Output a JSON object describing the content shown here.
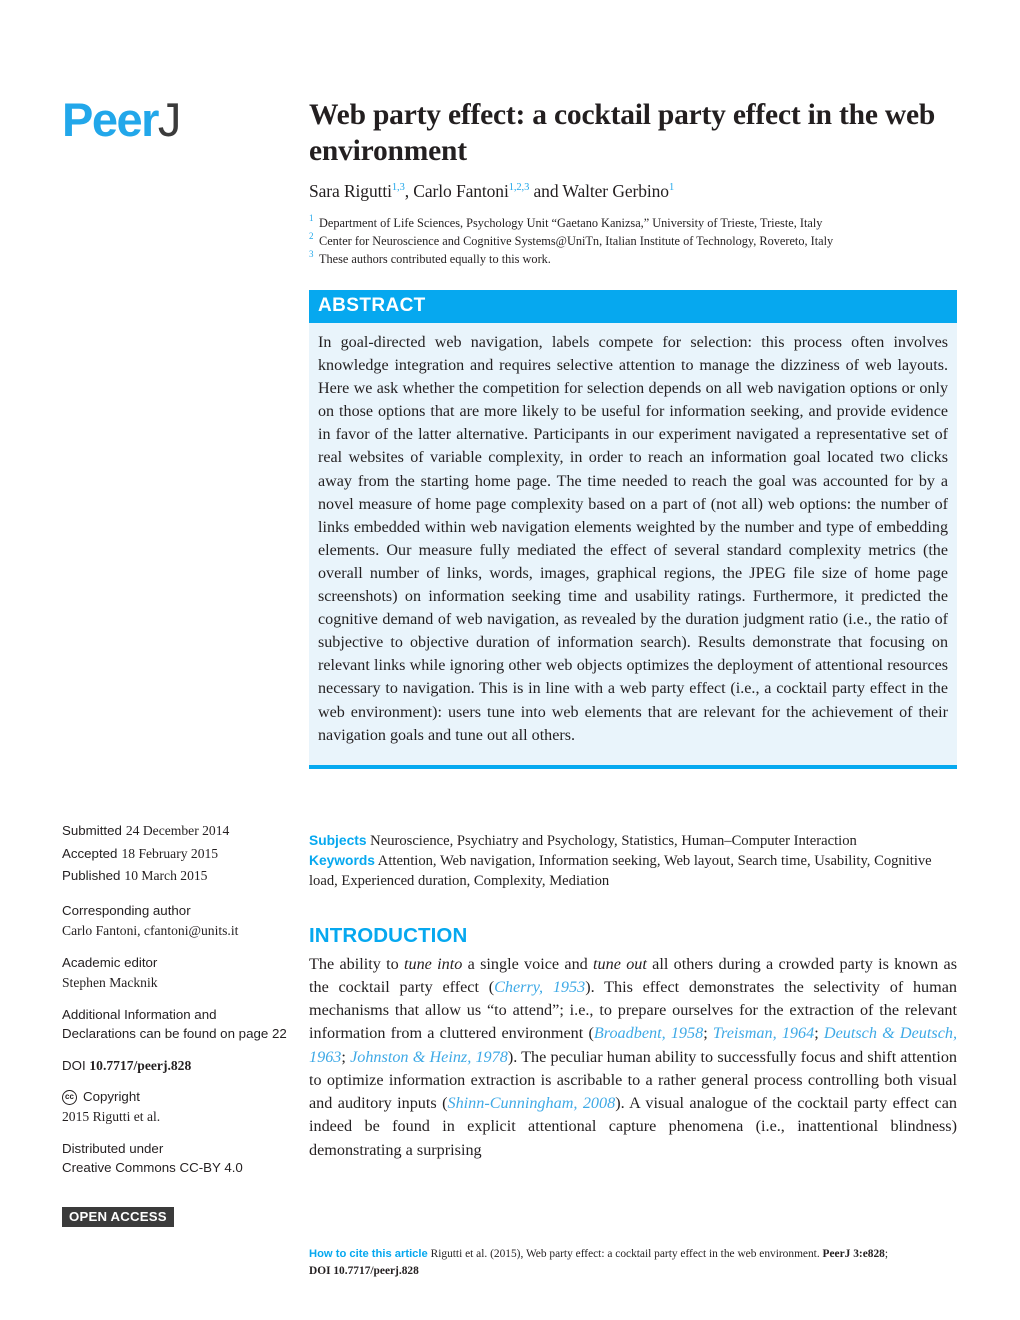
{
  "brand": {
    "logo_primary": "Peer",
    "logo_secondary": "J",
    "accent_blue": "#06a8ef",
    "logo_blue": "#22a7ea",
    "abstract_bg": "#e9f4fb",
    "citation_blue": "#3ea9e6",
    "badge_bg": "#3b3b3b"
  },
  "article": {
    "title": "Web party effect: a cocktail party effect in the web environment",
    "authors_html": "Sara Rigutti<sup>1,3</sup>, Carlo Fantoni<sup>1,2,3</sup> and Walter Gerbino<sup>1</sup>",
    "affiliations": [
      {
        "num": "1",
        "text": "Department of Life Sciences, Psychology Unit “Gaetano Kanizsa,” University of Trieste, Trieste, Italy"
      },
      {
        "num": "2",
        "text": "Center for Neuroscience and Cognitive Systems@UniTn, Italian Institute of Technology, Rovereto, Italy"
      },
      {
        "num": "3",
        "text": "These authors contributed equally to this work."
      }
    ]
  },
  "abstract": {
    "heading": "ABSTRACT",
    "text": "In goal-directed web navigation, labels compete for selection: this process often involves knowledge integration and requires selective attention to manage the dizziness of web layouts. Here we ask whether the competition for selection depends on all web navigation options or only on those options that are more likely to be useful for information seeking, and provide evidence in favor of the latter alternative. Participants in our experiment navigated a representative set of real websites of variable complexity, in order to reach an information goal located two clicks away from the starting home page. The time needed to reach the goal was accounted for by a novel measure of home page complexity based on a part of (not all) web options: the number of links embedded within web navigation elements weighted by the number and type of embedding elements. Our measure fully mediated the effect of several standard complexity metrics (the overall number of links, words, images, graphical regions, the JPEG file size of home page screenshots) on information seeking time and usability ratings. Furthermore, it predicted the cognitive demand of web navigation, as revealed by the duration judgment ratio (i.e., the ratio of subjective to objective duration of information search). Results demonstrate that focusing on relevant links while ignoring other web objects optimizes the deployment of attentional resources necessary to navigation. This is in line with a web party effect (i.e., a cocktail party effect in the web environment): users tune into web elements that are relevant for the achievement of their navigation goals and tune out all others."
  },
  "sidebar": {
    "submitted_label": "Submitted",
    "submitted_value": "24 December 2014",
    "accepted_label": "Accepted",
    "accepted_value": "18 February 2015",
    "published_label": "Published",
    "published_value": "10 March 2015",
    "corresponding_label": "Corresponding author",
    "corresponding_value": "Carlo Fantoni, cfantoni@units.it",
    "editor_label": "Academic editor",
    "editor_value": "Stephen Macknik",
    "additional_info": "Additional Information and Declarations can be found on page 22",
    "doi_label": "DOI",
    "doi_value": "10.7717/peerj.828",
    "copyright_label": "Copyright",
    "copyright_value": "2015  Rigutti et al.",
    "cc_icon_text": "cc",
    "license_line1": "Distributed under",
    "license_line2": "Creative Commons CC-BY 4.0",
    "open_access_badge": "OPEN ACCESS"
  },
  "meta": {
    "subjects_label": "Subjects",
    "subjects_value": "Neuroscience, Psychiatry and Psychology, Statistics, Human–Computer Interaction",
    "keywords_label": "Keywords",
    "keywords_value": "Attention, Web navigation, Information seeking, Web layout, Search time, Usability, Cognitive load, Experienced duration, Complexity, Mediation"
  },
  "introduction": {
    "heading": "INTRODUCTION",
    "paragraph_segments": [
      {
        "type": "plain",
        "text": "The ability to "
      },
      {
        "type": "italic",
        "text": "tune into"
      },
      {
        "type": "plain",
        "text": " a single voice and "
      },
      {
        "type": "italic",
        "text": "tune out"
      },
      {
        "type": "plain",
        "text": " all others during a crowded party is known as the cocktail party effect ("
      },
      {
        "type": "citation",
        "text": "Cherry, 1953"
      },
      {
        "type": "plain",
        "text": "). This effect demonstrates the selectivity of human mechanisms that allow us “to attend”; i.e., to prepare ourselves for the extraction of the relevant information from a cluttered environment ("
      },
      {
        "type": "citation",
        "text": "Broadbent, 1958"
      },
      {
        "type": "plain",
        "text": "; "
      },
      {
        "type": "citation",
        "text": "Treisman, 1964"
      },
      {
        "type": "plain",
        "text": "; "
      },
      {
        "type": "citation",
        "text": "Deutsch & Deutsch, 1963"
      },
      {
        "type": "plain",
        "text": "; "
      },
      {
        "type": "citation",
        "text": "Johnston & Heinz, 1978"
      },
      {
        "type": "plain",
        "text": "). The peculiar human ability to successfully focus and shift attention to optimize information extraction is ascribable to a rather general process controlling both visual and auditory inputs ("
      },
      {
        "type": "citation",
        "text": "Shinn-Cunningham, 2008"
      },
      {
        "type": "plain",
        "text": "). A visual analogue of the cocktail party effect can indeed be found in explicit attentional capture phenomena (i.e., inattentional blindness) demonstrating a surprising"
      }
    ]
  },
  "footer": {
    "howto_label": "How to cite this article",
    "citation_text": "Rigutti et al. (2015), Web party effect: a cocktail party effect in the web environment. ",
    "journal_ref": "PeerJ 3:e828",
    "semicolon": ";",
    "doi_line": "DOI 10.7717/peerj.828"
  }
}
